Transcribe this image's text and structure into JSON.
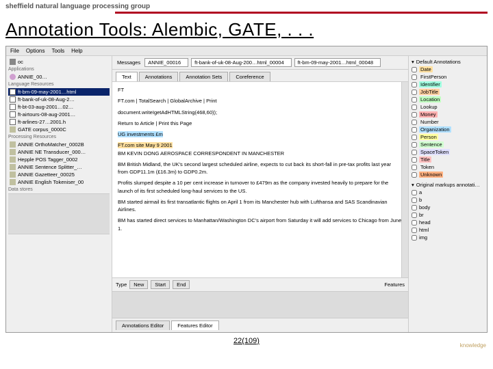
{
  "header": {
    "group_name": "sheffield natural language processing group",
    "title": "Annotation Tools: Alembic, GATE, . . ."
  },
  "menubar": [
    "File",
    "Options",
    "Tools",
    "Help"
  ],
  "left_panel": {
    "sections": {
      "apps": "Applications",
      "lang": "Language Resources",
      "proc": "Processing Resources",
      "data": "Data stores"
    },
    "apps_items": [
      {
        "label": "ANNIE_00…"
      }
    ],
    "lang_items": [
      {
        "label": "ft-bm-09-may-2001…html",
        "selected": true
      },
      {
        "label": "ft-bank-of-uk-08-Aug-2…"
      },
      {
        "label": "ft-bt-03-aug-2001…02…"
      },
      {
        "label": "ft-airtours-08-aug-2001…"
      },
      {
        "label": "ft-arlines-27…2001.h"
      },
      {
        "label": "GATE corpus_0000C"
      }
    ],
    "proc_items": [
      {
        "label": "ANNIE OrthoMatcher_0002B"
      },
      {
        "label": "ANNIE NE Transducer_000…"
      },
      {
        "label": "Hepple POS Tagger_0002"
      },
      {
        "label": "ANNIE Sentence Splitter_…"
      },
      {
        "label": "ANNIE Gazetteer_00025"
      },
      {
        "label": "ANNIE English Tokeniser_00"
      }
    ]
  },
  "top_bar": {
    "messages_label": "Messages",
    "sel1": "ANNIE_00016",
    "sel2": "ft-bank-of-uk-08-Aug-200…html_00004",
    "sel3": "ft-bm-09-may-2001…html_00048"
  },
  "tabs": [
    "Text",
    "Annotations",
    "Annotation Sets",
    "Coreference"
  ],
  "doc": {
    "line1": "FT",
    "line2": "FT.com | TotalSearch | GlobalArchive | Print",
    "line3": "document.writeIgetAdHTMLString(468,60));",
    "line4": "Return to Article | Print this Page",
    "line5": "UG investments £m",
    "line6_a": "FT.com site May 9 2001",
    "line6_b": "BM KEVIN DONG AEROSPACE CORRESPONDENT IN MANCHESTER",
    "line7": "BM British Midland, the UK's second largest scheduled airline, expects to cut back its short-fall in pre-tax profits last year from GDP11.1m (£16.3m) to GDP0.2m.",
    "line8": "Profits slumped despite a 10 per cent increase in turnover to £479m as the company invested heavily to prepare for the launch of its first scheduled long-haul services to the US.",
    "line9": "BM started airmail its first transatlantic flights on April 1 from its Manchester hub with Lufthansa and SAS Scandinavian Airlines.",
    "line10": "BM has started direct services to Manhattan/Washington DC's airport from Saturday it will add services to Chicago from June 1."
  },
  "bottom_controls": {
    "type_label": "Type",
    "buttons": [
      "New",
      "Start",
      "End"
    ],
    "features_label": "Features"
  },
  "bottom_tabs": [
    "Annotations Editor",
    "Features Editor"
  ],
  "right_panel": {
    "header": "Default Annotations",
    "header2": "Original markups annotati…",
    "types": [
      {
        "name": "Date",
        "color": "#ffe0a0"
      },
      {
        "name": "FirstPerson",
        "color": "#f0f0f0"
      },
      {
        "name": "Identifier",
        "color": "#a0ffe0"
      },
      {
        "name": "JobTitle",
        "color": "#ffd0a0"
      },
      {
        "name": "Location",
        "color": "#c0ffc0"
      },
      {
        "name": "Lookup",
        "color": "#f0f0f0"
      },
      {
        "name": "Money",
        "color": "#ffb0b0"
      },
      {
        "name": "Number",
        "color": "#f0f0f0"
      },
      {
        "name": "Organization",
        "color": "#b0e0ff"
      },
      {
        "name": "Person",
        "color": "#ffffa0"
      },
      {
        "name": "Sentence",
        "color": "#d0ffd0"
      },
      {
        "name": "SpaceToken",
        "color": "#e0e0ff"
      },
      {
        "name": "Title",
        "color": "#ffc0c0"
      },
      {
        "name": "Token",
        "color": "#f0f0f0"
      },
      {
        "name": "Unknown",
        "color": "#ffb080"
      }
    ],
    "markup_items": [
      "a",
      "b",
      "body",
      "br",
      "head",
      "html",
      "img"
    ]
  },
  "footer": "22(109)",
  "watermark": "knowledge"
}
